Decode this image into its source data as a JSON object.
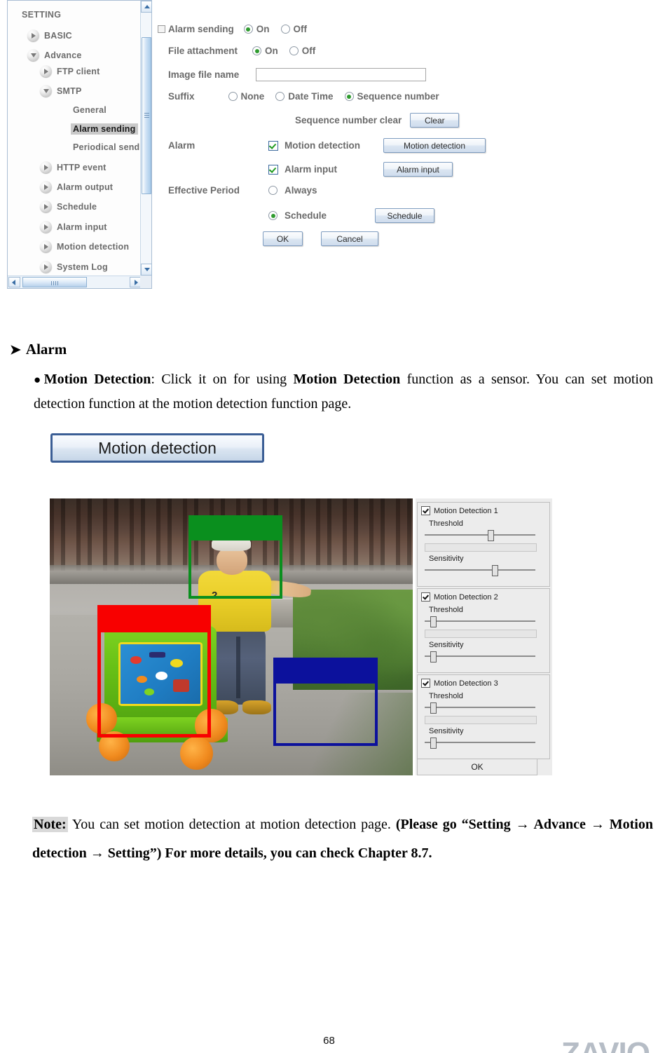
{
  "screenshot": {
    "tree": {
      "title": "SETTING",
      "nodes": [
        {
          "label": "BASIC",
          "icon": "collapsed-triangle-icon",
          "indent": 0,
          "selected": false
        },
        {
          "label": "Advance",
          "icon": "expanded-triangle-icon",
          "indent": 0,
          "selected": false
        },
        {
          "label": "FTP client",
          "icon": "collapsed-triangle-icon",
          "indent": 1,
          "selected": false
        },
        {
          "label": "SMTP",
          "icon": "expanded-triangle-icon",
          "indent": 1,
          "selected": false
        },
        {
          "label": "General",
          "icon": "none",
          "indent": 2,
          "selected": false
        },
        {
          "label": "Alarm sending",
          "icon": "none",
          "indent": 2,
          "selected": true
        },
        {
          "label": "Periodical send",
          "icon": "none",
          "indent": 2,
          "selected": false
        },
        {
          "label": "HTTP event",
          "icon": "collapsed-triangle-icon",
          "indent": 1,
          "selected": false
        },
        {
          "label": "Alarm output",
          "icon": "collapsed-triangle-icon",
          "indent": 1,
          "selected": false
        },
        {
          "label": "Schedule",
          "icon": "collapsed-triangle-icon",
          "indent": 1,
          "selected": false
        },
        {
          "label": "Alarm input",
          "icon": "collapsed-triangle-icon",
          "indent": 1,
          "selected": false
        },
        {
          "label": "Motion detection",
          "icon": "collapsed-triangle-icon",
          "indent": 1,
          "selected": false
        },
        {
          "label": "System Log",
          "icon": "collapsed-triangle-icon",
          "indent": 1,
          "selected": false
        }
      ]
    },
    "form": {
      "section_title": "Alarm sending",
      "alarm_sending": {
        "on": "On",
        "off": "Off",
        "selected": "On"
      },
      "file_attachment": {
        "label": "File attachment",
        "on": "On",
        "off": "Off",
        "selected": "On"
      },
      "image_file_name": {
        "label": "Image file name",
        "value": "",
        "placeholder": ""
      },
      "suffix": {
        "label": "Suffix",
        "options": [
          "None",
          "Date Time",
          "Sequence number"
        ],
        "selected": "Sequence number"
      },
      "sequence_clear": {
        "label": "Sequence number clear",
        "button": "Clear"
      },
      "alarm": {
        "label": "Alarm",
        "motion_detection": {
          "label": "Motion detection",
          "checked": true,
          "button": "Motion detection"
        },
        "alarm_input": {
          "label": "Alarm input",
          "checked": true,
          "button": "Alarm input"
        }
      },
      "effective_period": {
        "label": "Effective Period",
        "always": "Always",
        "schedule": "Schedule",
        "selected": "Schedule",
        "schedule_button": "Schedule"
      },
      "ok": "OK",
      "cancel": "Cancel"
    }
  },
  "document": {
    "heading": {
      "arrow": "➤",
      "text": "Alarm"
    },
    "bullet_paragraph": {
      "bullet": "●",
      "term": "Motion Detection",
      "text_1": ": Click it on for using ",
      "emphasis": "Motion Detection",
      "text_2": " function as a sensor. You can set motion detection function at the motion detection function page."
    },
    "motion_detection_button": "Motion detection",
    "note": {
      "tag": "Note:",
      "text_1": " You can set motion detection at motion detection page. ",
      "bold": "(Please go “Setting → Advance → Motion detection → Setting”) For more details, you can check Chapter 8.7."
    }
  },
  "camera_panel": {
    "zones": [
      {
        "name": "zone-1",
        "color": "#0a8f1e"
      },
      {
        "name": "zone-2",
        "color": "#f80000"
      },
      {
        "name": "zone-3",
        "color": "#0c119c"
      }
    ],
    "settings": {
      "groups": [
        {
          "title": "Motion Detection 1",
          "checked": true,
          "threshold_label": "Threshold",
          "threshold_value": 57,
          "sensitivity_label": "Sensitivity",
          "sensitivity_value": 61
        },
        {
          "title": "Motion Detection 2",
          "checked": true,
          "threshold_label": "Threshold",
          "threshold_value": 5,
          "sensitivity_label": "Sensitivity",
          "sensitivity_value": 5
        },
        {
          "title": "Motion Detection 3",
          "checked": true,
          "threshold_label": "Threshold",
          "threshold_value": 5,
          "sensitivity_label": "Sensitivity",
          "sensitivity_value": 5
        }
      ],
      "ok": "OK"
    }
  },
  "footer": {
    "page_number": "68",
    "logo": "ZAVIO"
  }
}
